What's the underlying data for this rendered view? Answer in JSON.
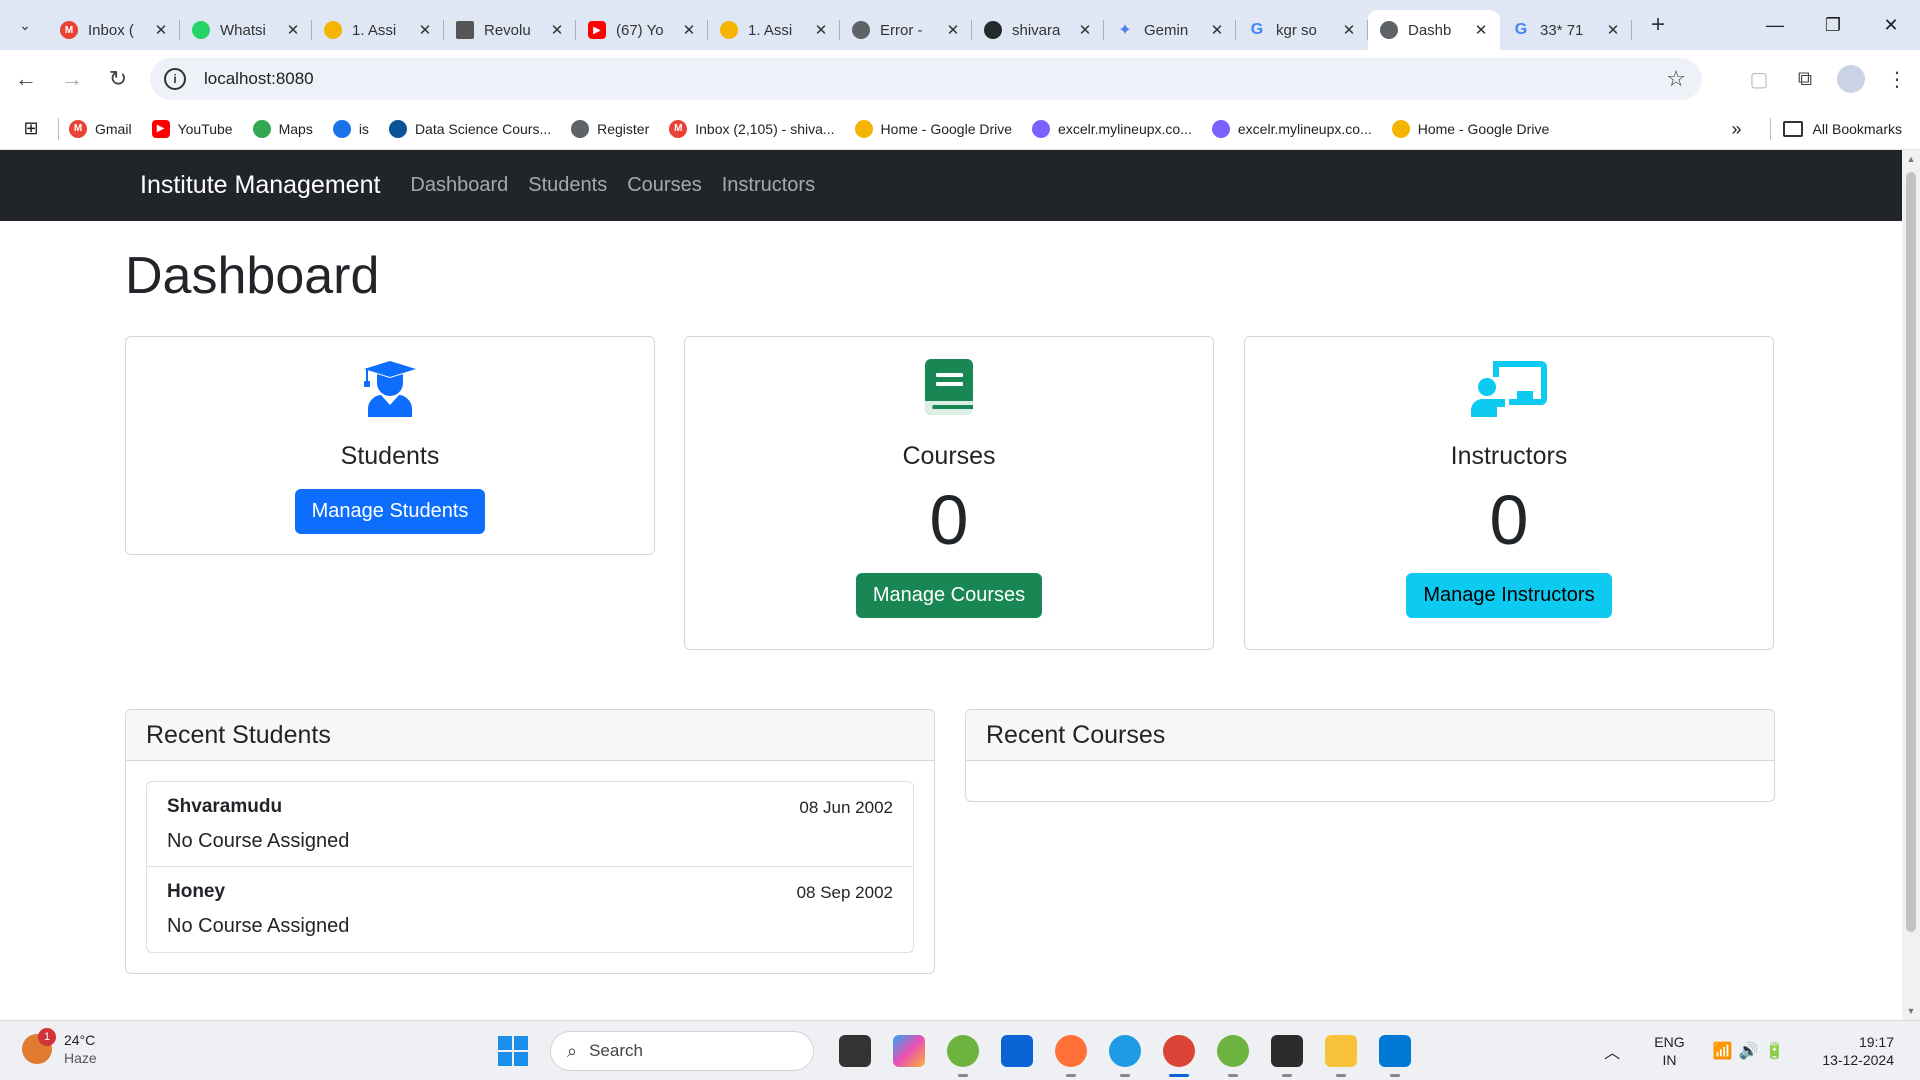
{
  "browser": {
    "tabs": [
      {
        "title": "Inbox (",
        "favicon": "gmail-icon",
        "color": "#ea4335"
      },
      {
        "title": "Whatsi",
        "favicon": "whatsapp-icon",
        "color": "#25d366"
      },
      {
        "title": "1. Assi",
        "favicon": "google-drive-icon",
        "color": "#f4b400"
      },
      {
        "title": "Revolu",
        "favicon": "site-icon",
        "color": "#555555"
      },
      {
        "title": "(67) Yo",
        "favicon": "youtube-icon",
        "color": "#ff0000"
      },
      {
        "title": "1. Assi",
        "favicon": "google-drive-icon",
        "color": "#f4b400"
      },
      {
        "title": "Error -",
        "favicon": "globe-icon",
        "color": "#5f6368"
      },
      {
        "title": "shivara",
        "favicon": "github-icon",
        "color": "#24292e"
      },
      {
        "title": "Gemin",
        "favicon": "gemini-icon",
        "color": "#4b7bec"
      },
      {
        "title": "kgr so",
        "favicon": "google-icon",
        "color": "#4285f4"
      },
      {
        "title": "Dashb",
        "favicon": "globe-icon",
        "color": "#5f6368"
      },
      {
        "title": "33* 71",
        "favicon": "google-icon",
        "color": "#4285f4"
      }
    ],
    "url": "localhost:8080",
    "bookmarks": [
      {
        "label": "Gmail",
        "icon": "gmail-icon",
        "color": "#ea4335"
      },
      {
        "label": "YouTube",
        "icon": "youtube-icon",
        "color": "#ff0000"
      },
      {
        "label": "Maps",
        "icon": "maps-icon",
        "color": "#34a853"
      },
      {
        "label": "is",
        "icon": "site-icon",
        "color": "#1a73e8"
      },
      {
        "label": "Data Science Cours...",
        "icon": "site-icon",
        "color": "#0b5394"
      },
      {
        "label": "Register",
        "icon": "globe-icon",
        "color": "#5f6368"
      },
      {
        "label": "Inbox (2,105) - shiva...",
        "icon": "gmail-icon",
        "color": "#ea4335"
      },
      {
        "label": "Home - Google Drive",
        "icon": "google-drive-icon",
        "color": "#f4b400"
      },
      {
        "label": "excelr.mylineupx.co...",
        "icon": "site-icon",
        "color": "#7b61ff"
      },
      {
        "label": "excelr.mylineupx.co...",
        "icon": "site-icon",
        "color": "#7b61ff"
      },
      {
        "label": "Home - Google Drive",
        "icon": "google-drive-icon",
        "color": "#f4b400"
      }
    ],
    "all_bookmarks_label": "All Bookmarks"
  },
  "app": {
    "brand": "Institute Management",
    "nav": {
      "dashboard": "Dashboard",
      "students": "Students",
      "courses": "Courses",
      "instructors": "Instructors"
    },
    "page_title": "Dashboard",
    "cards": {
      "students": {
        "title": "Students",
        "button": "Manage Students",
        "icon": "graduate-icon"
      },
      "courses": {
        "title": "Courses",
        "count": "0",
        "button": "Manage Courses",
        "icon": "book-icon"
      },
      "instructors": {
        "title": "Instructors",
        "count": "0",
        "button": "Manage Instructors",
        "icon": "instructor-icon"
      }
    },
    "recent_students": {
      "title": "Recent Students",
      "items": [
        {
          "name": "Shvaramudu",
          "date": "08 Jun 2002",
          "course": "No Course Assigned"
        },
        {
          "name": "Honey",
          "date": "08 Sep 2002",
          "course": "No Course Assigned"
        }
      ]
    },
    "recent_courses": {
      "title": "Recent Courses"
    },
    "colors": {
      "primary": "#0d6efd",
      "success": "#198754",
      "info": "#0dcaf0",
      "navbar": "#212529"
    }
  },
  "taskbar": {
    "weather": {
      "temp": "24°C",
      "condition": "Haze",
      "badge": "1"
    },
    "search_placeholder": "Search",
    "language": {
      "line1": "ENG",
      "line2": "IN"
    },
    "time": "19:17",
    "date": "13-12-2024"
  }
}
